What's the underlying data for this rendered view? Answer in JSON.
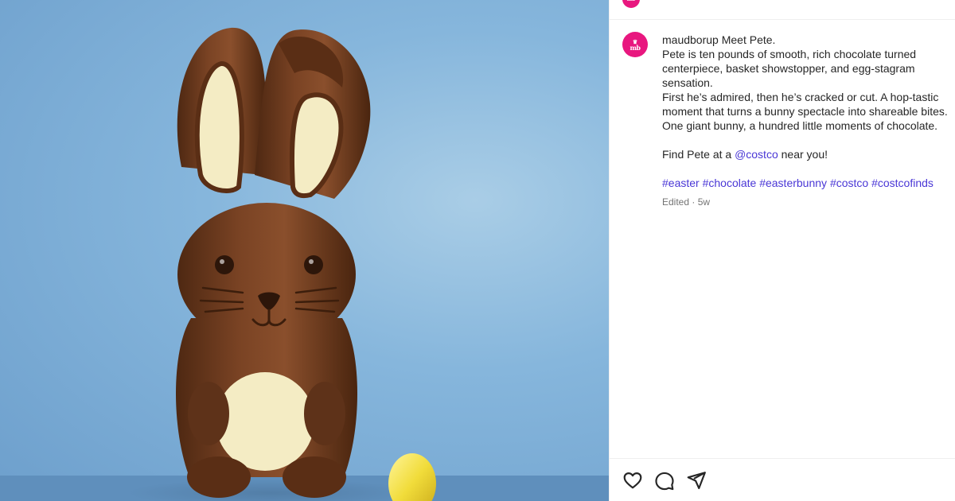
{
  "post": {
    "username": "maudborup",
    "avatar_initials": "mb",
    "avatar_crown": "♛",
    "caption": {
      "title": "Meet Pete.",
      "line1": "Pete is ten pounds of smooth, rich chocolate turned",
      "line2": "centerpiece, basket showstopper, and egg-stagram",
      "line3": "sensation.",
      "line4": "First he’s admired, then he’s cracked or cut. A hop-tastic",
      "line5": "moment that turns a bunny spectacle into shareable bites.",
      "line6": "One giant bunny, a hundred little moments of chocolate.",
      "find_prefix": "Find Pete at a ",
      "mention": "@costco",
      "find_suffix": " near you!",
      "hashtags": [
        "#easter",
        "#chocolate",
        "#easterbunny",
        "#costco",
        "#costcofinds"
      ]
    },
    "meta": "Edited · 5w"
  },
  "actions": {
    "like_icon": "heart-icon",
    "comment_icon": "comment-icon",
    "share_icon": "share-icon"
  },
  "colors": {
    "brand": "#e8177f",
    "link": "#4a37d6",
    "text": "#262626",
    "muted": "#737373",
    "backdrop": "#86b6dc",
    "chocolate": "#6b3a1f",
    "white_chocolate": "#f4ecc4",
    "egg": "#f1dc3a"
  }
}
